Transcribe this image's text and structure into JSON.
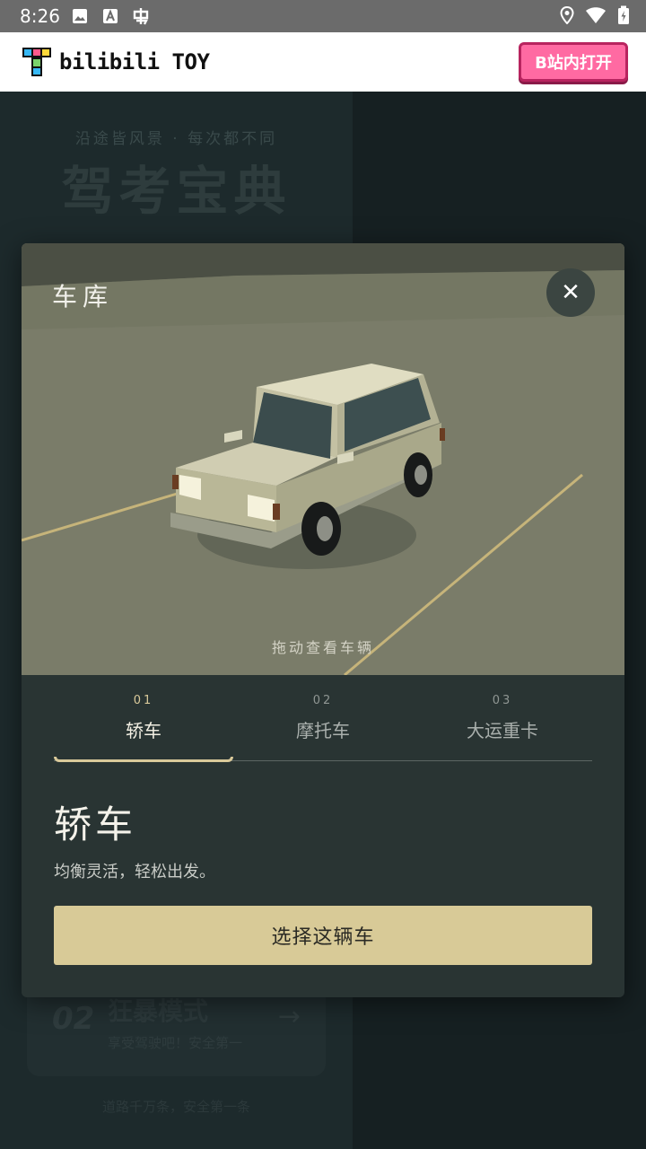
{
  "status_bar": {
    "time": "8:26"
  },
  "app_header": {
    "logo_text": "bilibili TOY",
    "open_button": "B站内打开"
  },
  "background_page": {
    "subtitle": "沿途皆风景 · 每次都不同",
    "title": "驾考宝典",
    "card": {
      "number": "02",
      "title": "狂暴模式",
      "subtitle": "享受驾驶吧！安全第一",
      "arrow": "→"
    },
    "footer": "道路千万条，安全第一条"
  },
  "garage": {
    "title": "车库",
    "close": "✕",
    "drag_hint": "拖动查看车辆",
    "tabs": [
      {
        "index": "01",
        "label": "轿车"
      },
      {
        "index": "02",
        "label": "摩托车"
      },
      {
        "index": "03",
        "label": "大运重卡"
      }
    ],
    "selected": {
      "name": "轿车",
      "description": "均衡灵活，轻松出发。"
    },
    "select_button": "选择这辆车"
  }
}
